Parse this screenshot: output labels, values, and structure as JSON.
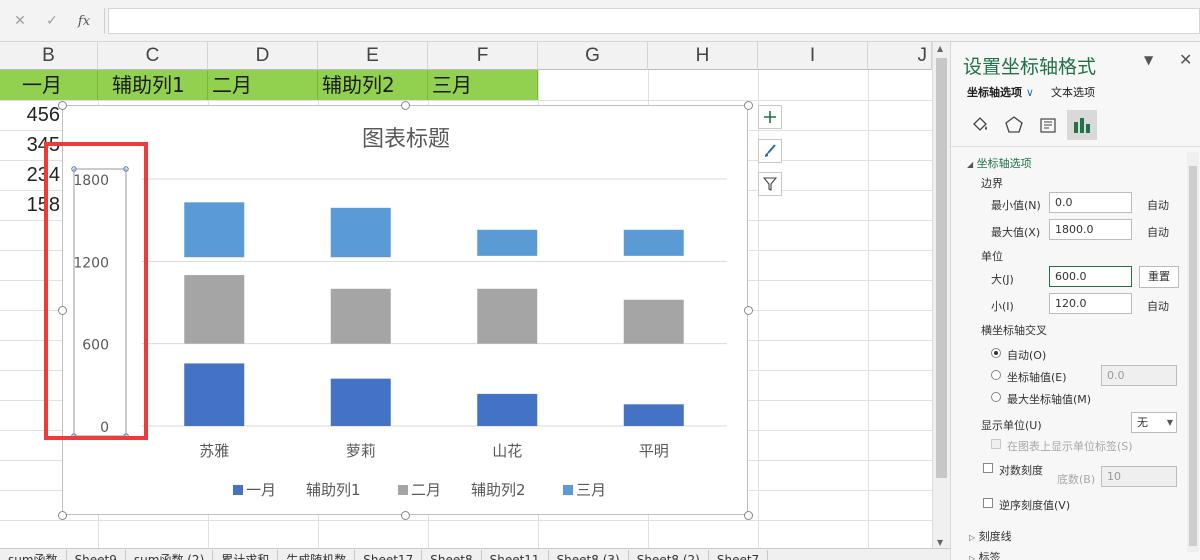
{
  "formula_bar": {
    "cancel_icon": "✕",
    "confirm_icon": "✓",
    "fx_label": "fx",
    "value": ""
  },
  "columns": [
    "B",
    "C",
    "D",
    "E",
    "F",
    "G",
    "H",
    "I",
    "J"
  ],
  "table": {
    "headers": [
      "一月",
      "辅助列1",
      "二月",
      "辅助列2",
      "三月"
    ],
    "col_b_values": [
      "456",
      "345",
      "234",
      "158"
    ]
  },
  "chart": {
    "title": "图表标题",
    "y_ticks": [
      "1800",
      "1200",
      "600",
      "0"
    ],
    "legend": [
      "一月",
      "辅助列1",
      "二月",
      "辅助列2",
      "三月"
    ]
  },
  "chart_data": {
    "type": "bar",
    "stacked": true,
    "categories": [
      "苏雅",
      "萝莉",
      "山花",
      "平明"
    ],
    "series": [
      {
        "name": "一月",
        "color": "#4472c4",
        "values": [
          456,
          345,
          234,
          158
        ]
      },
      {
        "name": "辅助列1",
        "color": "#ffffff",
        "values": [
          144,
          255,
          366,
          442
        ]
      },
      {
        "name": "二月",
        "color": "#a5a5a5",
        "values": [
          500,
          400,
          400,
          320
        ]
      },
      {
        "name": "辅助列2",
        "color": "#ffffff",
        "values": [
          130,
          230,
          240,
          320
        ]
      },
      {
        "name": "三月",
        "color": "#5b9bd5",
        "values": [
          400,
          360,
          190,
          190
        ]
      }
    ],
    "ylim": [
      0,
      1800
    ],
    "y_major_unit": 600,
    "grid": true,
    "legend_position": "bottom"
  },
  "side_buttons": [
    "+",
    "brush",
    "filter"
  ],
  "sheet_tabs": [
    "sum函数",
    "Sheet9",
    "sum函数 (2)",
    "累计求和",
    "生成随机数",
    "Sheet17",
    "Sheet8",
    "Sheet11",
    "Sheet8 (3)",
    "Sheet8 (2)",
    "Sheet7"
  ],
  "pane": {
    "title": "设置坐标轴格式",
    "tab_axis_options": "坐标轴选项",
    "tab_text_options": "文本选项",
    "section_axis_options": "坐标轴选项",
    "bounds_label": "边界",
    "min_label": "最小值(N)",
    "min_value": "0.0",
    "min_auto": "自动",
    "max_label": "最大值(X)",
    "max_value": "1800.0",
    "max_auto": "自动",
    "units_label": "单位",
    "major_label": "大(J)",
    "major_value": "600.0",
    "major_reset": "重置",
    "minor_label": "小(I)",
    "minor_value": "120.0",
    "minor_auto": "自动",
    "cross_label": "横坐标轴交叉",
    "cross_auto": "自动(O)",
    "cross_value_label": "坐标轴值(E)",
    "cross_value": "0.0",
    "cross_max": "最大坐标轴值(M)",
    "display_units_label": "显示单位(U)",
    "display_units_value": "无",
    "show_units_label": "在图表上显示单位标签(S)",
    "log_scale_label": "对数刻度",
    "log_base_label": "底数(B)",
    "log_base_value": "10",
    "reverse_label": "逆序刻度值(V)",
    "ticks_label": "刻度线",
    "labels_label": "标签"
  },
  "colors": {
    "header_fill": "#92d050",
    "excel_green": "#217346",
    "highlight_red": "#ee3a3a"
  }
}
